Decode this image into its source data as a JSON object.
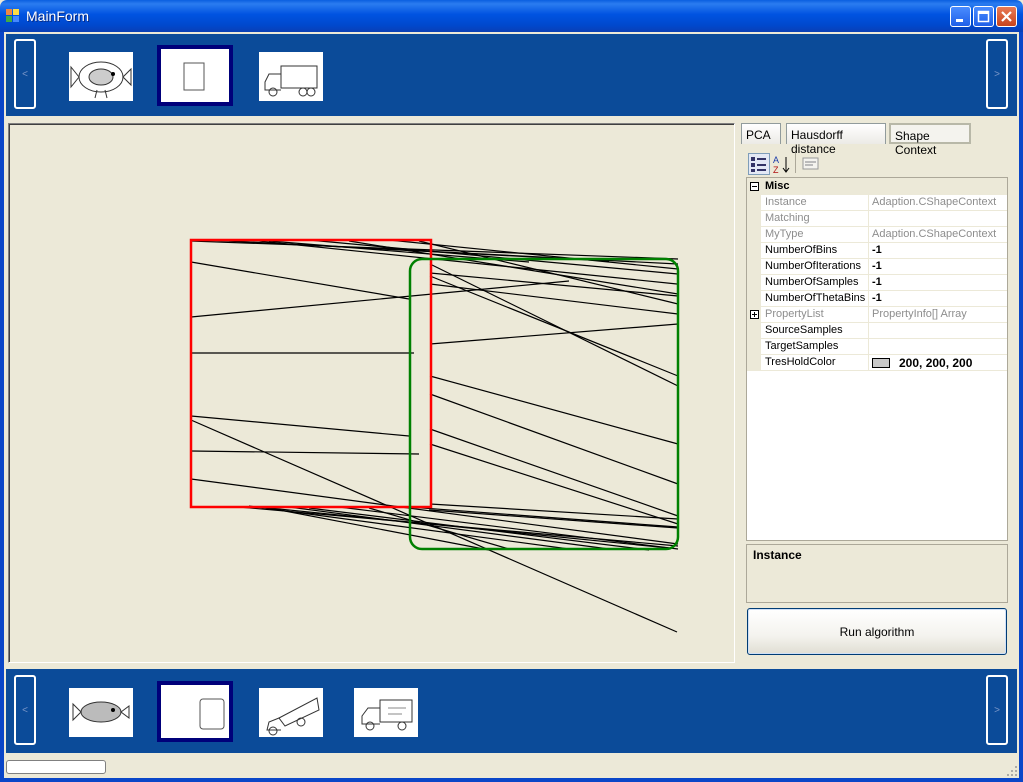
{
  "window": {
    "title": "MainForm"
  },
  "strips": {
    "prev_label": "<",
    "next_label": ">"
  },
  "tabs": [
    "PCA",
    "Hausdorff distance",
    "Shape Context"
  ],
  "property_grid": {
    "category": "Misc",
    "rows": [
      {
        "name": "Instance",
        "value": "Adaption.CShapeContext",
        "readonly": true
      },
      {
        "name": "Matching",
        "value": "",
        "readonly": true
      },
      {
        "name": "MyType",
        "value": "Adaption.CShapeContext",
        "readonly": true
      },
      {
        "name": "NumberOfBins",
        "value": "-1",
        "readonly": false
      },
      {
        "name": "NumberOfIterations",
        "value": "-1",
        "readonly": false
      },
      {
        "name": "NumberOfSamples",
        "value": "-1",
        "readonly": false
      },
      {
        "name": "NumberOfThetaBins",
        "value": "-1",
        "readonly": false
      },
      {
        "name": "PropertyList",
        "value": "PropertyInfo[] Array",
        "readonly": true
      },
      {
        "name": "SourceSamples",
        "value": "",
        "readonly": false
      },
      {
        "name": "TargetSamples",
        "value": "",
        "readonly": false
      },
      {
        "name": "TresHoldColor",
        "value": "200, 200, 200",
        "readonly": false
      }
    ],
    "help_title": "Instance"
  },
  "run_button": "Run algorithm",
  "colors": {
    "source_shape": "#ff0000",
    "target_shape": "#008000",
    "strip": "#0b4b99",
    "threshold_swatch": "#c8c8c8"
  }
}
